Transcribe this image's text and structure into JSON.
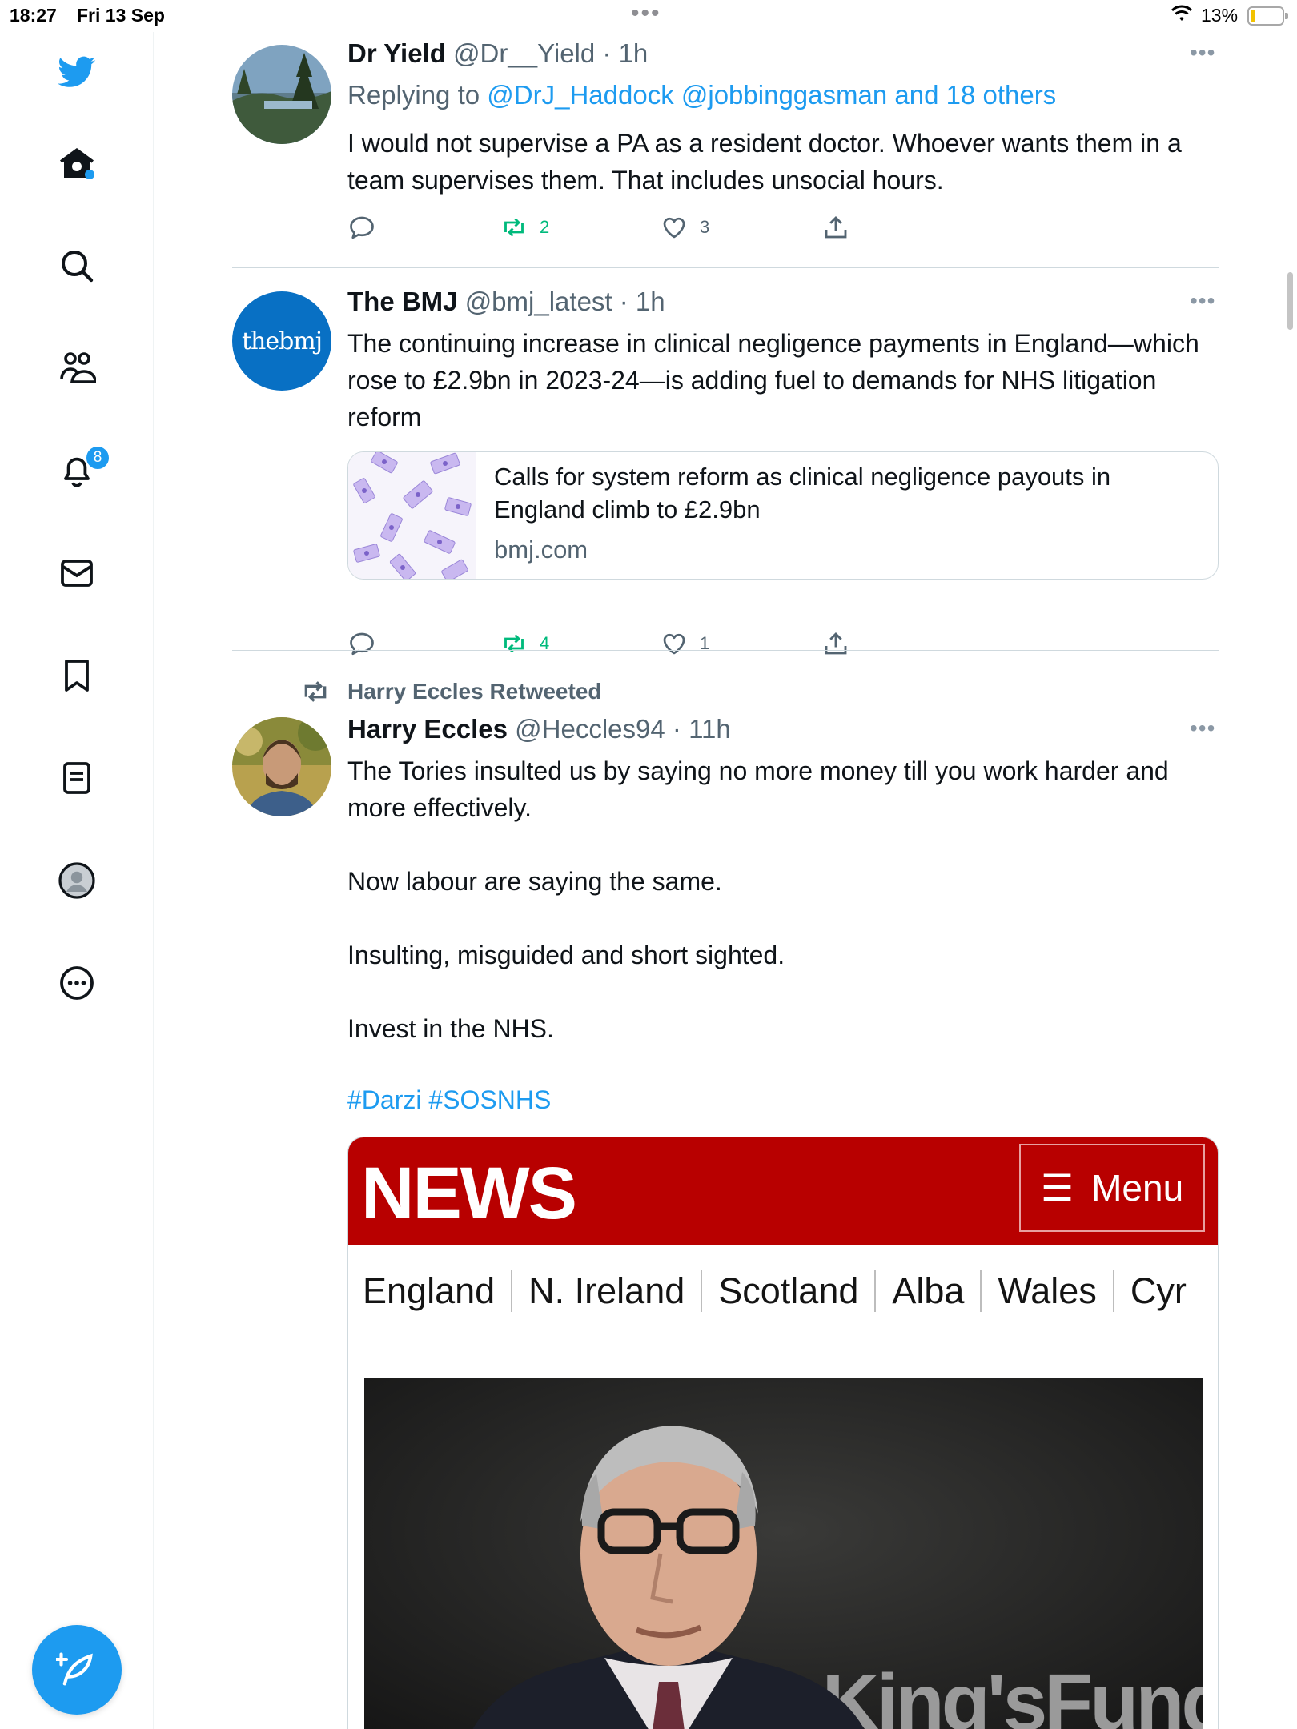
{
  "status_bar": {
    "time": "18:27",
    "date": "Fri 13 Sep",
    "battery": "13%"
  },
  "sidebar": {
    "items": [
      {
        "name": "home",
        "icon": "twitter-bird-icon"
      },
      {
        "name": "home",
        "icon": "home-icon"
      },
      {
        "name": "explore",
        "icon": "search-icon"
      },
      {
        "name": "communities",
        "icon": "people-icon"
      },
      {
        "name": "notifications",
        "icon": "bell-icon"
      },
      {
        "name": "messages",
        "icon": "mail-icon"
      },
      {
        "name": "bookmarks",
        "icon": "bookmark-icon"
      },
      {
        "name": "lists",
        "icon": "list-icon"
      },
      {
        "name": "profile",
        "icon": "profile-icon"
      },
      {
        "name": "more",
        "icon": "more-circle-icon"
      }
    ],
    "notification_badge": "8"
  },
  "tweets": [
    {
      "name": "Dr Yield",
      "handle": "@Dr__Yield",
      "time": "· 1h",
      "replying_prefix": "Replying to",
      "replying_to": "@DrJ_Haddock @jobbinggasman and 18 others",
      "text": "I would not supervise a PA as a resident doctor. Whoever wants them in a team supervises them. That includes unsocial hours.",
      "replies": "",
      "retweets": "2",
      "likes": "3"
    },
    {
      "name": "The BMJ",
      "handle": "@bmj_latest",
      "time": "· 1h",
      "avatar_text": "thebmj",
      "text": "The continuing increase in clinical negligence payments in England—which rose to £2.9bn in 2023-24—is adding fuel to demands for NHS litigation reform",
      "card": {
        "title": "Calls for system reform as clinical negligence payouts in England climb to £2.9bn",
        "domain": "bmj.com"
      },
      "replies": "",
      "retweets": "4",
      "likes": "1"
    },
    {
      "retweeted_by": "Harry Eccles Retweeted",
      "name": "Harry Eccles",
      "handle": "@Heccles94",
      "time": "· 11h",
      "paragraphs": [
        "The Tories insulted us by saying no more money till you work harder and more effectively.",
        "Now labour are saying the same.",
        "Insulting, misguided and short sighted.",
        "Invest in the NHS."
      ],
      "hashtags": "#Darzi #SOSNHS",
      "media": {
        "brand": "NEWS",
        "menu": "Menu",
        "regions": [
          "England",
          "N. Ireland",
          "Scotland",
          "Alba",
          "Wales",
          "Cyr"
        ],
        "photo_backdrop": "eKing'sFund›"
      }
    }
  ],
  "colors": {
    "accent": "#1d9bf0",
    "retweet_green": "#00ba7c",
    "bbc_red": "#b80000"
  }
}
